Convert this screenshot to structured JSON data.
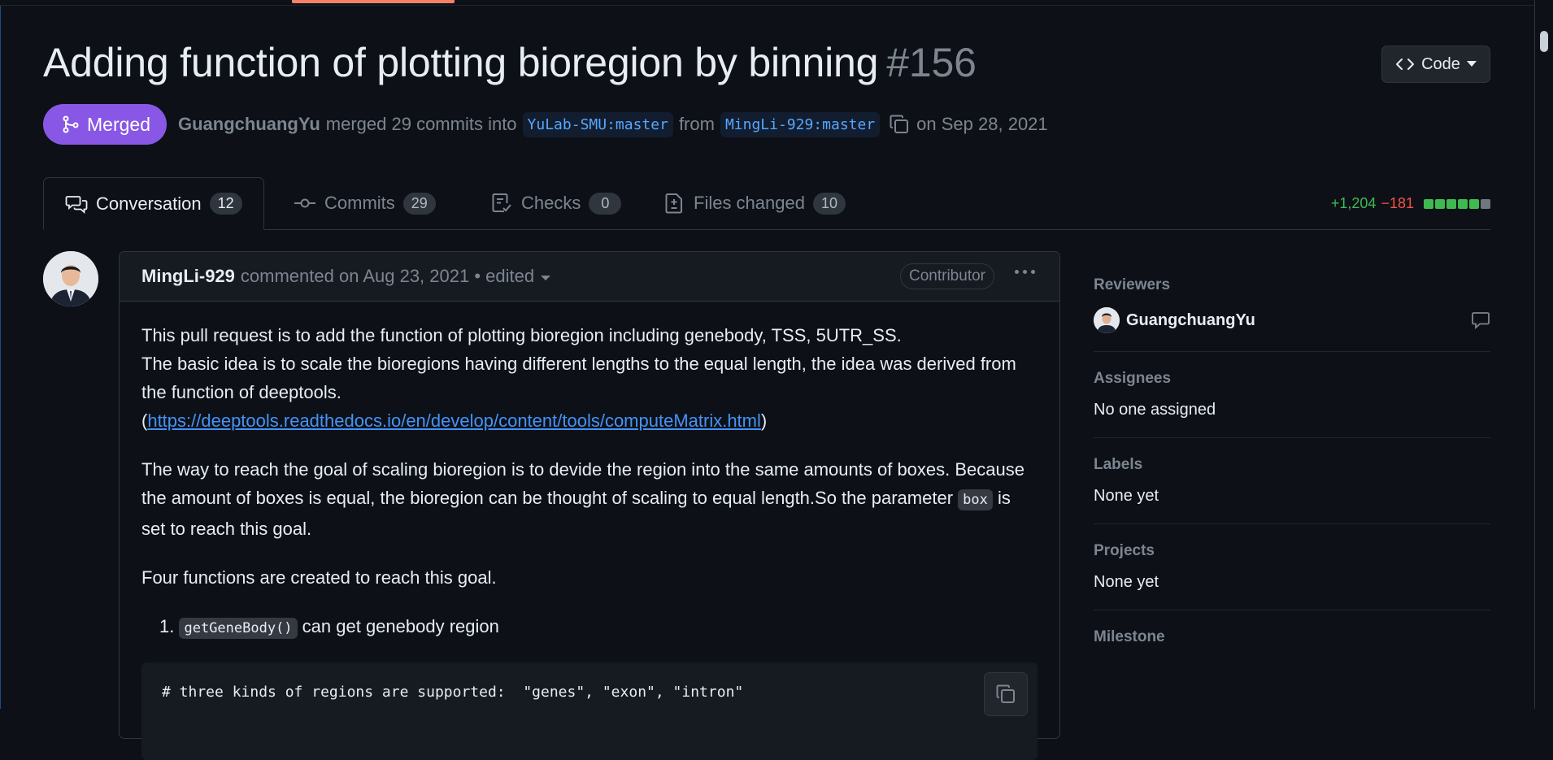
{
  "pr": {
    "title": "Adding function of plotting bioregion by binning",
    "number": "#156",
    "status": "Merged",
    "merged_by": "GuangchuangYu",
    "merged_text": "merged 29 commits into",
    "base_branch": "YuLab-SMU:master",
    "from_text": "from",
    "head_branch": "MingLi-929:master",
    "date_text": "on Sep 28, 2021"
  },
  "code_button": {
    "label": "Code"
  },
  "tabs": [
    {
      "label": "Conversation",
      "count": "12",
      "icon": "comment-discussion-icon"
    },
    {
      "label": "Commits",
      "count": "29",
      "icon": "commit-icon"
    },
    {
      "label": "Checks",
      "count": "0",
      "icon": "checklist-icon"
    },
    {
      "label": "Files changed",
      "count": "10",
      "icon": "file-diff-icon"
    }
  ],
  "diffstat": {
    "additions": "+1,204",
    "deletions": "−181",
    "box_colors": [
      "#3fb950",
      "#3fb950",
      "#3fb950",
      "#3fb950",
      "#3fb950",
      "#6e7681"
    ]
  },
  "comment": {
    "author": "MingLi-929",
    "meta": "commented on Aug 23, 2021 • edited",
    "role": "Contributor",
    "paragraphs": {
      "p1_line1": "This pull request is to add the function of plotting bioregion including genebody, TSS, 5UTR_SS.",
      "p1_line2": "The basic idea is to scale the bioregions having different lengths to the equal length, the idea was derived from the function of deeptools.",
      "link_open": "(",
      "link": "https://deeptools.readthedocs.io/en/develop/content/tools/computeMatrix.html",
      "link_close": ")",
      "p2_a": "The way to reach the goal of scaling bioregion is to devide the region into the same amounts of boxes. Because the amount of boxes is equal, the bioregion can be thought of scaling to equal length.So the parameter",
      "p2_code": "box",
      "p2_b": "is set to reach this goal.",
      "p3": "Four functions are created to reach this goal.",
      "li1_num": "1.",
      "li1_code": "getGeneBody()",
      "li1_text": "can get genebody region",
      "code": "# three kinds of regions are supported:  \"genes\", \"exon\", \"intron\""
    }
  },
  "sidebar": {
    "reviewers": {
      "title": "Reviewers",
      "name": "GuangchuangYu"
    },
    "assignees": {
      "title": "Assignees",
      "value": "No one assigned"
    },
    "labels": {
      "title": "Labels",
      "value": "None yet"
    },
    "projects": {
      "title": "Projects",
      "value": "None yet"
    },
    "milestone": {
      "title": "Milestone"
    }
  },
  "colors": {
    "merged": "#8957e5",
    "link": "#4493f8",
    "background": "#0d1117"
  }
}
